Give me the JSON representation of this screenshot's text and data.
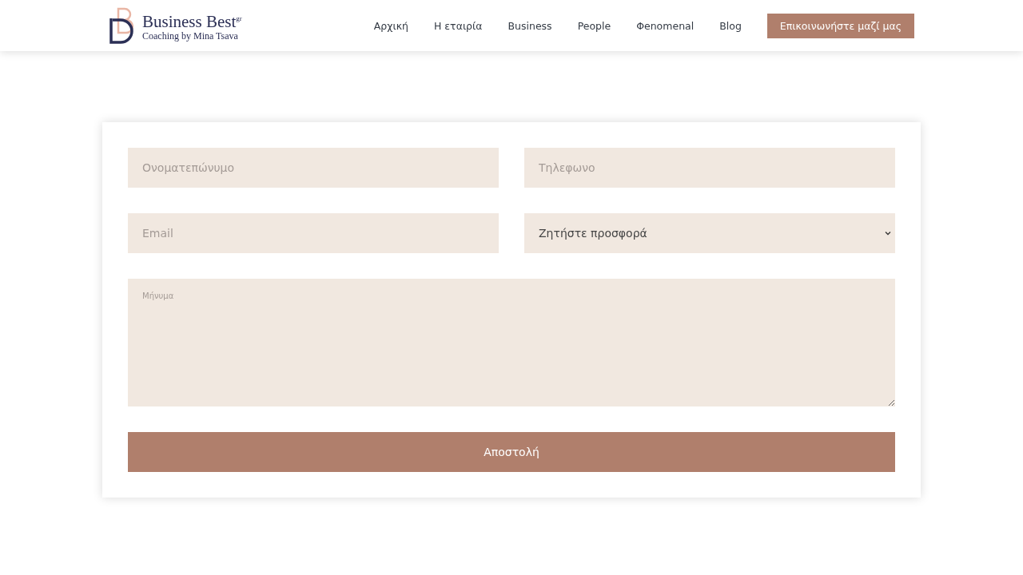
{
  "header": {
    "logo": {
      "title": "Business Best$^{gr}$",
      "subtitle": "Coaching by Mina Tsava"
    },
    "nav": [
      {
        "label": "Αρχική"
      },
      {
        "label": "Η εταιρία"
      },
      {
        "label": "Business"
      },
      {
        "label": "People"
      },
      {
        "label": "Φenomenal"
      },
      {
        "label": "Blog"
      }
    ],
    "cta": "Επικοινωνήστε μαζί μας"
  },
  "form": {
    "fields": [
      {
        "kind": "input",
        "placeholder": "Ονοματεπώνυμο"
      },
      {
        "kind": "input",
        "placeholder": "Τηλεφωνο"
      },
      {
        "kind": "input",
        "placeholder": "Email"
      },
      {
        "kind": "select",
        "value": "Ζητήστε προσφορά"
      },
      {
        "kind": "textarea",
        "placeholder": "Μήνυμα"
      }
    ],
    "submit": "Αποστολή"
  }
}
